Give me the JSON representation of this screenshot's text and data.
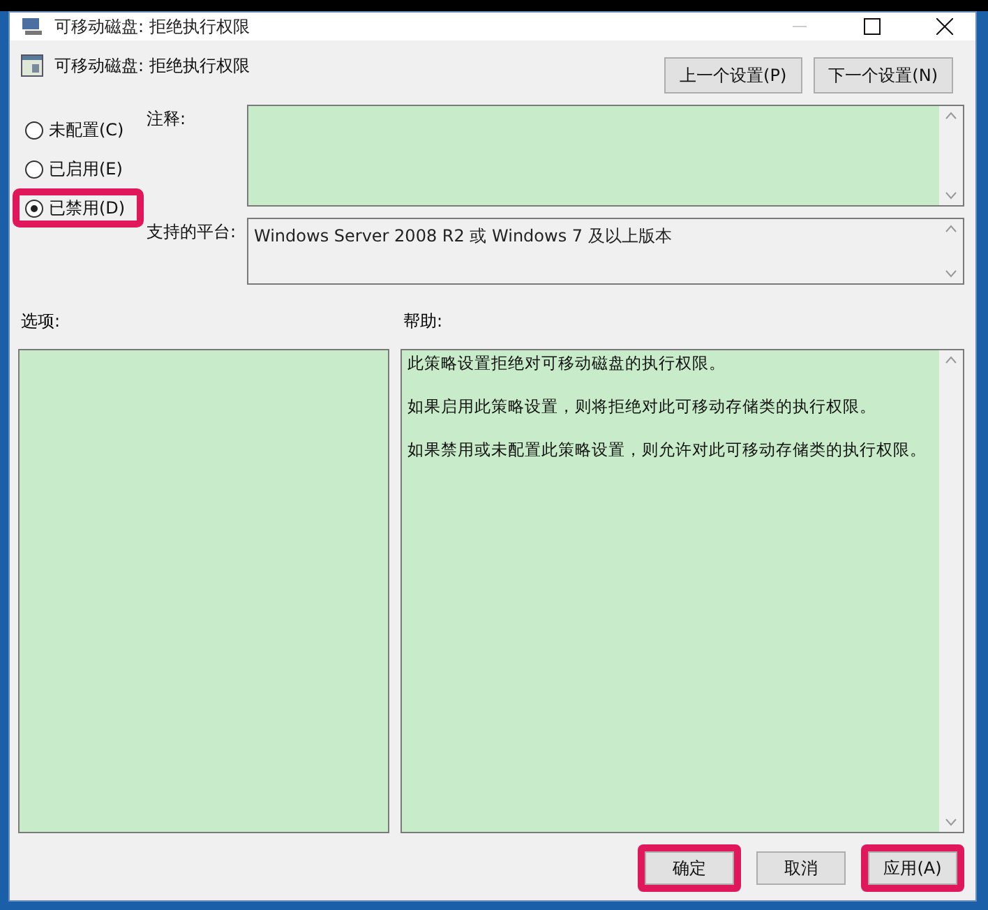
{
  "window": {
    "title": "可移动磁盘: 拒绝执行权限"
  },
  "header": {
    "title": "可移动磁盘: 拒绝执行权限"
  },
  "nav_buttons": [
    {
      "label": "上一个设置(P)"
    },
    {
      "label": "下一个设置(N)"
    }
  ],
  "state_options": [
    {
      "label": "未配置(C)",
      "selected": false,
      "highlighted": false
    },
    {
      "label": "已启用(E)",
      "selected": false,
      "highlighted": false
    },
    {
      "label": "已禁用(D)",
      "selected": true,
      "highlighted": true
    }
  ],
  "comment": {
    "label": "注释:"
  },
  "supported_on": {
    "label": "支持的平台:",
    "value": "Windows Server 2008 R2 或 Windows 7 及以上版本"
  },
  "options": {
    "label": "选项:"
  },
  "help": {
    "label": "帮助:",
    "paragraphs": [
      "此策略设置拒绝对可移动磁盘的执行权限。",
      "如果启用此策略设置，则将拒绝对此可移动存储类的执行权限。",
      "如果禁用或未配置此策略设置，则允许对此可移动存储类的执行权限。"
    ]
  },
  "buttons": [
    {
      "label": "确定",
      "highlighted": true
    },
    {
      "label": "取消",
      "highlighted": false
    },
    {
      "label": "应用(A)",
      "highlighted": true
    }
  ]
}
